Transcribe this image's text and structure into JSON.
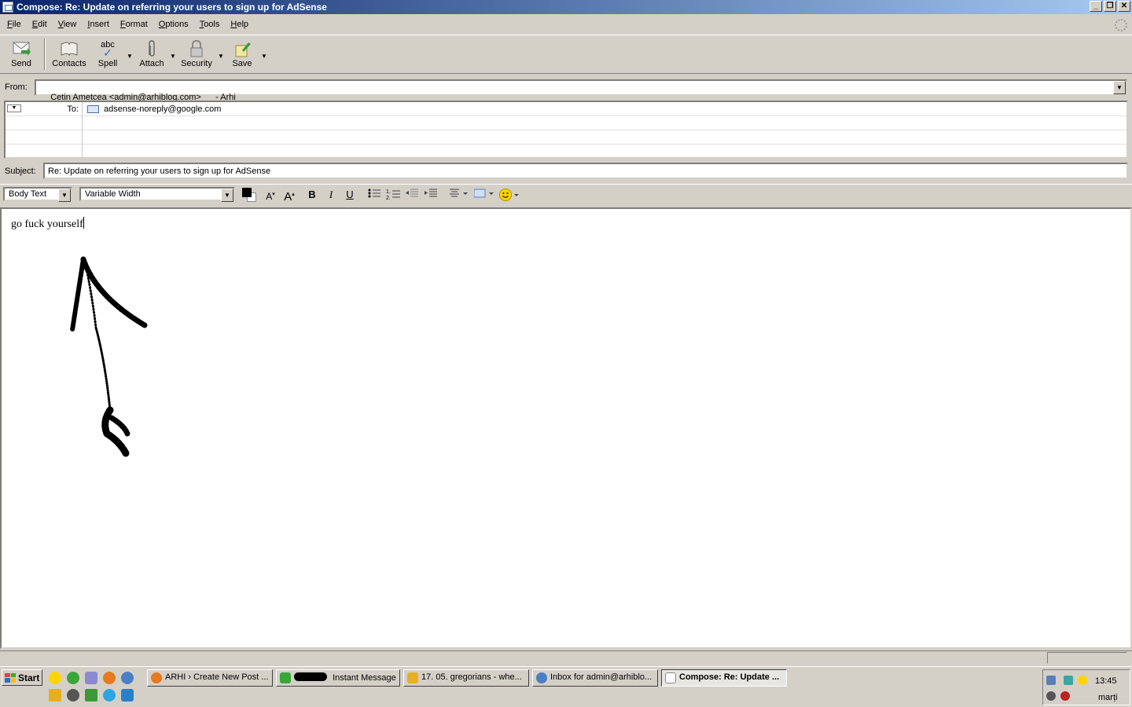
{
  "window": {
    "title": "Compose: Re: Update on referring your users to sign up for AdSense"
  },
  "menu": [
    "File",
    "Edit",
    "View",
    "Insert",
    "Format",
    "Options",
    "Tools",
    "Help"
  ],
  "toolbar": {
    "send": "Send",
    "contacts": "Contacts",
    "spell": "Spell",
    "spell_icon_text": "abc",
    "attach": "Attach",
    "security": "Security",
    "save": "Save"
  },
  "from": {
    "label": "From:",
    "value": "Cetin Ametcea <admin@arhiblog.com>      - Arhi"
  },
  "recipients": [
    {
      "type": "To:",
      "address": "adsense-noreply@google.com"
    }
  ],
  "subject": {
    "label": "Subject:",
    "value": "Re: Update on referring your users to sign up for AdSense"
  },
  "format": {
    "paragraph": "Body Text",
    "font": "Variable Width",
    "bold": "B",
    "italic": "I",
    "underline": "U",
    "text_color": "#000000",
    "bg_color": "#ffffff"
  },
  "body": {
    "text": "go fuck yourself"
  },
  "taskbar": {
    "start": "Start",
    "tasks": [
      {
        "label": "ARHI › Create New Post ..."
      },
      {
        "label": "Instant Message"
      },
      {
        "label": "17. 05. gregorians - whe..."
      },
      {
        "label": "Inbox for admin@arhiblo..."
      },
      {
        "label": "Compose: Re: Update ..."
      }
    ],
    "clock": "13:45",
    "day": "marți"
  }
}
